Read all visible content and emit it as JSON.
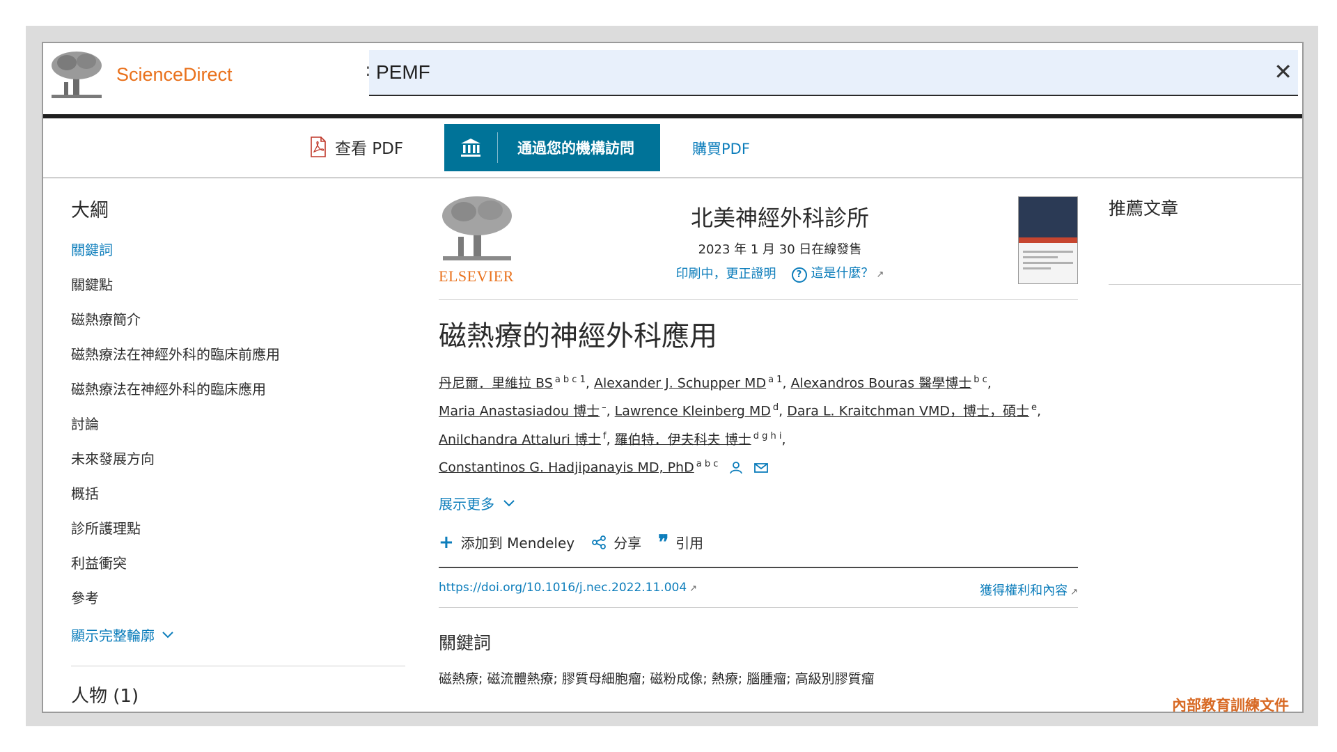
{
  "header": {
    "site_name": "ScienceDirect",
    "search_value": "PEMF",
    "close_icon": "close-icon"
  },
  "toolbar": {
    "view_pdf_label": "查看 PDF",
    "access_label": "通過您的機構訪問",
    "buy_pdf_label": "購買PDF",
    "access_button_color": "#007398"
  },
  "outline": {
    "title": "大綱",
    "items": [
      {
        "label": "關鍵詞",
        "active": true
      },
      {
        "label": "關鍵點"
      },
      {
        "label": "磁熱療簡介"
      },
      {
        "label": "磁熱療法在神經外科的臨床前應用"
      },
      {
        "label": "磁熱療法在神經外科的臨床應用"
      },
      {
        "label": "討論"
      },
      {
        "label": "未來發展方向"
      },
      {
        "label": "概括"
      },
      {
        "label": "診所護理點"
      },
      {
        "label": "利益衝突"
      },
      {
        "label": "參考"
      }
    ],
    "show_full": "顯示完整輪廓",
    "people": "人物 (1)"
  },
  "article": {
    "publisher": "ELSEVIER",
    "journal": "北美神經外科診所",
    "date": "2023 年 1 月 30 日在線發售",
    "in_press": "印刷中，更正證明",
    "what_is_this": "這是什麼？",
    "title": "磁熱療的神經外科應用",
    "authors": [
      {
        "name": "丹尼爾．里維拉 BS",
        "sup": "a b c 1",
        "sep": ","
      },
      {
        "name": "Alexander J. Schupper MD",
        "sup": "a 1",
        "sep": ","
      },
      {
        "name": "Alexandros Bouras 醫學博士",
        "sup": "b c",
        "sep": ","
      },
      {
        "name": "Maria Anastasiadou 博士",
        "sup": "–",
        "sep": ","
      },
      {
        "name": "Lawrence Kleinberg MD",
        "sup": "d",
        "sep": ","
      },
      {
        "name": "Dara L. Kraitchman VMD，博士，碩士",
        "sup": "e",
        "sep": ","
      },
      {
        "name": "Anilchandra Attaluri 博士",
        "sup": "f",
        "sep": ","
      },
      {
        "name": "羅伯特．伊夫科夫 博士",
        "sup": "d g h i",
        "sep": ","
      },
      {
        "name": "Constantinos G. Hadjipanayis MD, PhD",
        "sup": "a b c",
        "sep": ""
      }
    ],
    "show_more": "展示更多",
    "add_mendeley": "添加到 Mendeley",
    "share": "分享",
    "cite": "引用",
    "doi": "https://doi.org/10.1016/j.nec.2022.11.004",
    "rights": "獲得權利和內容",
    "keywords_heading": "關鍵詞",
    "keywords": "磁熱療; 磁流體熱療; 膠質母細胞瘤; 磁粉成像; 熱療; 腦腫瘤; 高級別膠質瘤"
  },
  "sidebar": {
    "recommended_title": "推薦文章"
  },
  "watermark": "內部教育訓練文件",
  "colors": {
    "link": "#0c7dbb",
    "brand_orange": "#e9711c"
  }
}
